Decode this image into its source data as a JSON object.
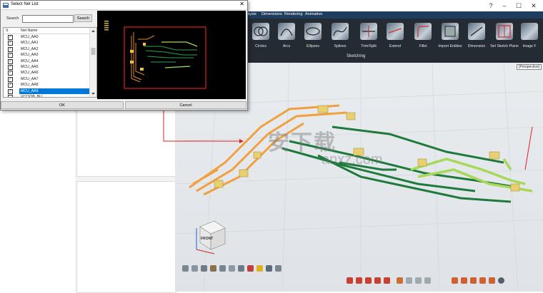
{
  "dialog": {
    "title": "Select Net List",
    "close_glyph": "✕",
    "search_label": "Search",
    "search_value": "",
    "search_button": "Search",
    "col_s": "S",
    "col_net": "Net Name",
    "nets": [
      {
        "name": "MCU_AA0",
        "checked": true
      },
      {
        "name": "MCU_AA1",
        "checked": true
      },
      {
        "name": "MCU_AA2",
        "checked": true
      },
      {
        "name": "MCU_AA3",
        "checked": true
      },
      {
        "name": "MCU_AA4",
        "checked": true
      },
      {
        "name": "MCU_AA5",
        "checked": true
      },
      {
        "name": "MCU_AA6",
        "checked": true
      },
      {
        "name": "MCU_AA7",
        "checked": true
      },
      {
        "name": "MCU_AA8",
        "checked": true
      },
      {
        "name": "MCU_AA9",
        "checked": true,
        "selected": true
      },
      {
        "name": "VCCIOB_BU",
        "checked": false
      }
    ],
    "ok_label": "OK",
    "cancel_label": "Cancel"
  },
  "app": {
    "window_controls": [
      "?",
      "–",
      "☐",
      "✕"
    ],
    "menu": [
      "alysis",
      "Dimensions",
      "Rendering",
      "Animation"
    ],
    "ribbon_tools": [
      "Circles",
      "Arcs",
      "Ellipses",
      "Splines",
      "Trim/Split",
      "Extend",
      "Fillet",
      "Import Entities",
      "Dimension",
      "Set Sketch Plane",
      "Image F"
    ],
    "ribbon_group": "Sketching",
    "viewport_mode": "[Perspective]",
    "view_cube_label": "FRONT",
    "watermark": "安下载",
    "watermark_sub": "anxz.com"
  },
  "colors": {
    "menubar": "#1f3d5f",
    "ribbon": "#252b33",
    "trace_green": "#1d7a3a",
    "trace_lime": "#a8d85a",
    "trace_orange": "#f0a040",
    "highlight": "#e02020",
    "selection": "#0078d7"
  }
}
